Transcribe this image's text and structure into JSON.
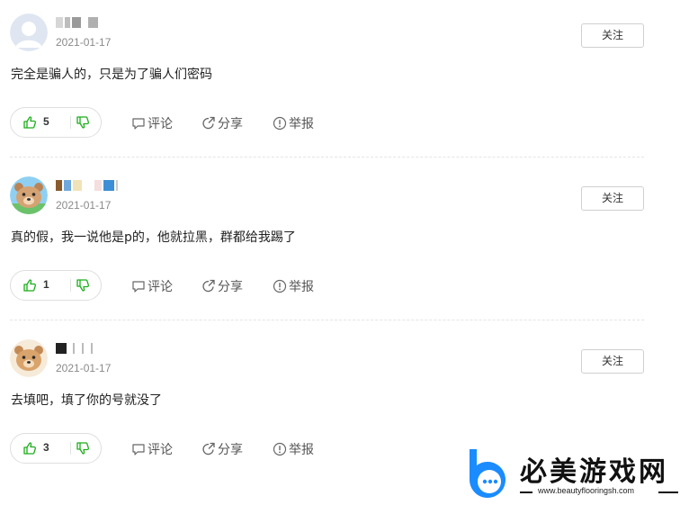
{
  "comments": [
    {
      "date": "2021-01-17",
      "follow_label": "关注",
      "text": "完全是骗人的，只是为了骗人们密码",
      "likes": "5",
      "actions": {
        "comment": "评论",
        "share": "分享",
        "report": "举报"
      }
    },
    {
      "date": "2021-01-17",
      "follow_label": "关注",
      "text": "真的假，我一说他是p的，他就拉黑，群都给我踢了",
      "likes": "1",
      "actions": {
        "comment": "评论",
        "share": "分享",
        "report": "举报"
      }
    },
    {
      "date": "2021-01-17",
      "follow_label": "关注",
      "text": "去填吧，填了你的号就没了",
      "likes": "3",
      "actions": {
        "comment": "评论",
        "share": "分享",
        "report": "举报"
      }
    }
  ],
  "watermark": {
    "title": "必美游戏网",
    "url": "www.beautyflooringsh.com"
  },
  "colors": {
    "like_green": "#1aad19",
    "avatar_gray": "#c5cedd",
    "bear_brown": "#d4a273",
    "watermark_blue": "#1a8cff"
  },
  "icons": {
    "like": "thumbs-up-icon",
    "dislike": "thumbs-down-icon",
    "comment": "comment-icon",
    "share": "share-icon",
    "report": "report-icon"
  }
}
